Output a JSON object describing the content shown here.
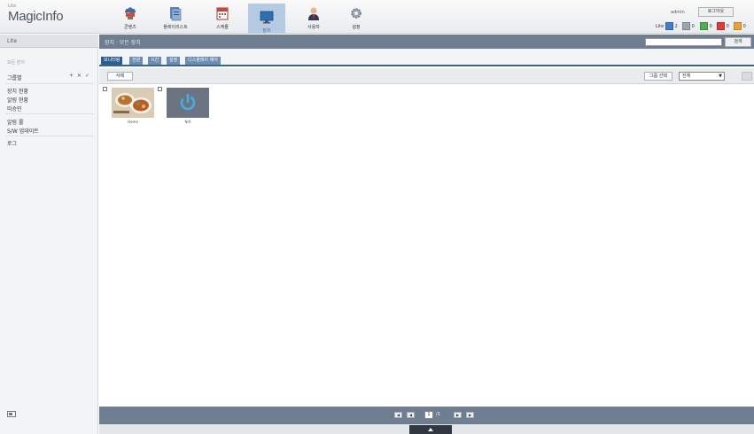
{
  "header": {
    "logo_small": "Lite",
    "logo_text": "MagicInfo",
    "nav": [
      {
        "label": "콘텐츠",
        "icon": "content-icon"
      },
      {
        "label": "플레이리스트",
        "icon": "playlist-icon"
      },
      {
        "label": "스케줄",
        "icon": "schedule-icon"
      },
      {
        "label": "장치",
        "icon": "device-icon"
      },
      {
        "label": "사용자",
        "icon": "user-icon"
      },
      {
        "label": "설정",
        "icon": "settings-icon"
      }
    ],
    "user_name": "admin",
    "logout_label": "로그아웃",
    "status": {
      "prefix": "Lite",
      "items": [
        {
          "count": "2",
          "color": "#3d7fd4"
        },
        {
          "count": "0",
          "color": "#9aa6b2"
        },
        {
          "count": "0",
          "color": "#4caf50"
        },
        {
          "count": "0",
          "color": "#e53935"
        },
        {
          "count": "0",
          "color": "#f0a030"
        }
      ]
    }
  },
  "sidebar": {
    "title": "Lite",
    "caption": "모든 장치",
    "group_label": "그룹별",
    "group_tools": "+ ✕ ✓",
    "items": [
      "장치 현황",
      "알림 현황",
      "미승인",
      "알림 룰",
      "S/W 업데이트",
      "로그"
    ]
  },
  "main": {
    "breadcrumb": "장치 · 모든 장치",
    "search": {
      "value": "",
      "placeholder": ""
    },
    "search_button": "검색",
    "tabs": [
      "모니터링",
      "전원",
      "시간",
      "설정",
      "디스플레이 제어"
    ],
    "toolbar": {
      "delete_label": "삭제",
      "group_select_label": "그룹 선택",
      "view_select_value": "전체"
    },
    "devices": [
      {
        "name": "Home",
        "thumb": "food-thumbnail"
      },
      {
        "name": "N/A",
        "thumb": "power-icon"
      }
    ],
    "pager": {
      "current": "1",
      "total": "/1"
    }
  },
  "colors": {
    "accent": "#2e5e91",
    "bar": "#6d7e90",
    "nav_active": "#b5cbe3"
  }
}
